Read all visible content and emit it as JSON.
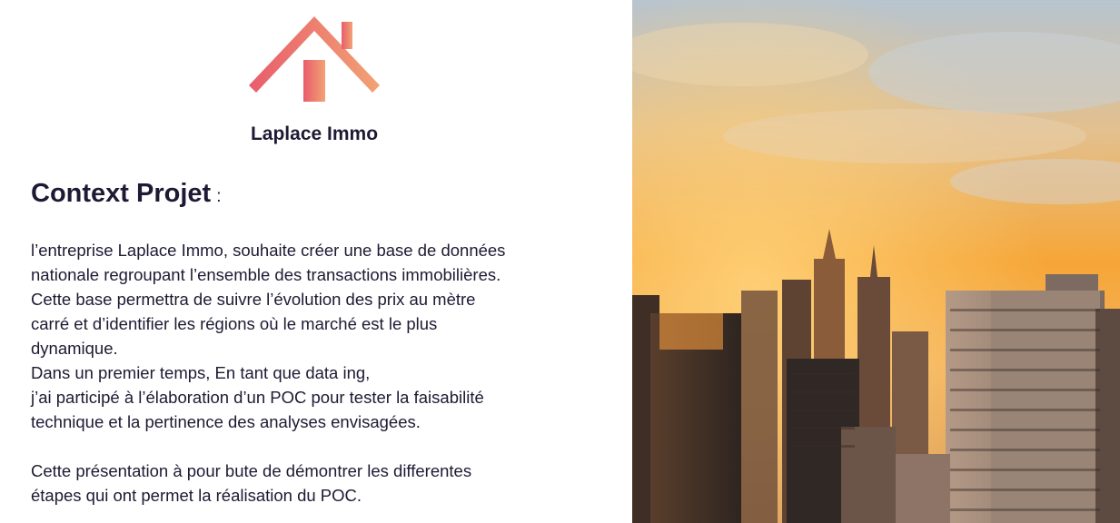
{
  "brand": {
    "name": "Laplace Immo",
    "logo_icon": "house-icon"
  },
  "context": {
    "title": "Context Projet",
    "colon": ":",
    "lines": [
      "l’entreprise Laplace Immo, souhaite créer une base de données",
      "nationale regroupant l’ensemble  des transactions immobilières.",
      "Cette base permettra de suivre l’évolution des prix au mètre",
      "carré  et d’identifier les régions où le marché est le plus",
      "dynamique.",
      "Dans un premier temps, En tant que data ing,",
      "j’ai participé à l’élaboration  d’un POC  pour tester la faisabilité",
      "technique et la pertinence des analyses envisagées."
    ],
    "closing_lines": [
      "Cette présentation à pour bute de démontrer les differentes",
      "étapes qui ont permet la réalisation du POC."
    ]
  },
  "image": {
    "subject": "city-skyline-sunset",
    "colors": {
      "sky_top": "#a9bfd3",
      "sky_glow": "#f7a53a",
      "accent": "#e8636f"
    }
  }
}
